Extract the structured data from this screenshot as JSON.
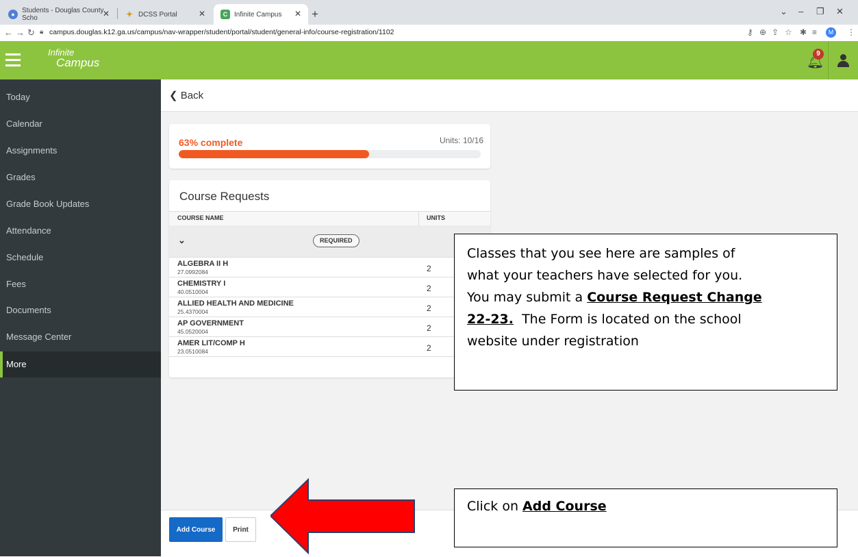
{
  "browser": {
    "tabs": [
      {
        "label": "Students - Douglas County Scho",
        "fav": "globe-icon"
      },
      {
        "label": "DCSS Portal",
        "fav": "star-icon"
      },
      {
        "label": "Infinite Campus",
        "fav": "C"
      }
    ],
    "url": "campus.douglas.k12.ga.us/campus/nav-wrapper/student/portal/student/general-info/course-registration/1102",
    "profile_initial": "M"
  },
  "header": {
    "logo_line1": "Infinite",
    "logo_line2": "Campus",
    "notification_count": "9",
    "accent_color": "#8dc43f"
  },
  "sidebar": {
    "items": [
      {
        "label": "Today"
      },
      {
        "label": "Calendar"
      },
      {
        "label": "Assignments"
      },
      {
        "label": "Grades"
      },
      {
        "label": "Grade Book Updates"
      },
      {
        "label": "Attendance"
      },
      {
        "label": "Schedule"
      },
      {
        "label": "Fees"
      },
      {
        "label": "Documents"
      },
      {
        "label": "Message Center"
      },
      {
        "label": "More"
      }
    ],
    "active_index": 10
  },
  "main": {
    "back_label": "Back",
    "progress": {
      "label": "63% complete",
      "percent": 63,
      "units_label": "Units: 10/16",
      "color": "#f05a22"
    },
    "course_requests": {
      "title": "Course Requests",
      "col_name": "COURSE NAME",
      "col_units": "UNITS",
      "group_label": "REQUIRED",
      "courses": [
        {
          "name": "ALGEBRA II H",
          "code": "27.0992084",
          "units": "2"
        },
        {
          "name": "CHEMISTRY I",
          "code": "40.0510004",
          "units": "2"
        },
        {
          "name": "ALLIED HEALTH AND MEDICINE",
          "code": "25.4370004",
          "units": "2"
        },
        {
          "name": "AP GOVERNMENT",
          "code": "45.0520004",
          "units": "2"
        },
        {
          "name": "AMER LIT/COMP H",
          "code": "23.0510084",
          "units": "2"
        }
      ]
    },
    "add_course_label": "Add Course",
    "print_label": "Print"
  },
  "annotations": {
    "callout1": {
      "line1": "Classes that you see here are samples of",
      "line2": "what your teachers have selected for you.",
      "line3_pre": "You may submit a ",
      "line3_bold": "Course Request Change",
      "line4_bold": "22-23.",
      "line4_post": "  The Form is located on the school",
      "line5": "website under registration"
    },
    "callout2": {
      "pre": "Click on ",
      "bold": "Add Course"
    },
    "arrow_color": "#ff0000"
  }
}
